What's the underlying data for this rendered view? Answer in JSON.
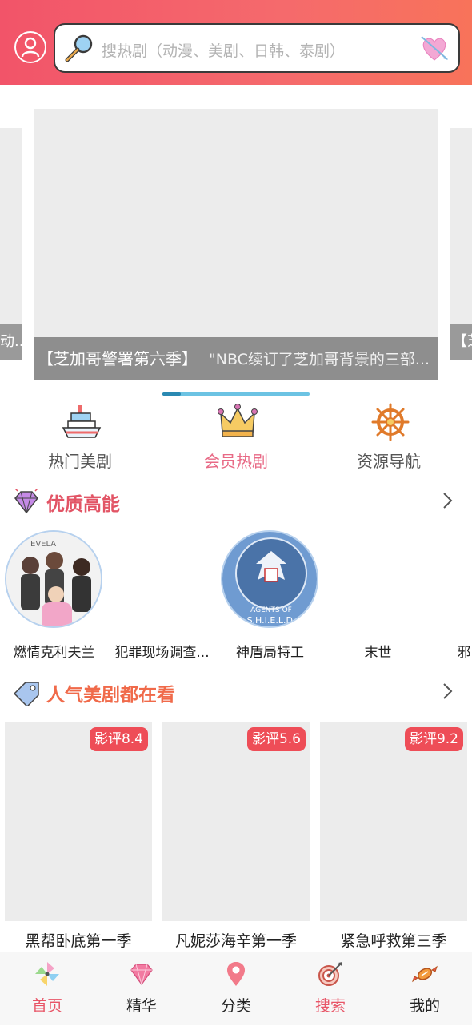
{
  "header": {
    "search_placeholder": "搜热剧（动漫、美剧、日韩、泰剧）"
  },
  "banner": {
    "left_card_caption": "动...",
    "right_card_caption": "【芝",
    "title": "【芝加哥警署第六季】",
    "description": "\"NBC续订了芝加哥背景的三部..."
  },
  "quick_nav": [
    {
      "label": "热门美剧",
      "icon": "ship-icon"
    },
    {
      "label": "会员热剧",
      "icon": "crown-icon"
    },
    {
      "label": "资源导航",
      "icon": "ship-wheel-icon"
    }
  ],
  "section_quality": {
    "title": "优质高能",
    "items": [
      "燃情克利夫兰",
      "犯罪现场调查...",
      "神盾局特工",
      "末世",
      "邪"
    ]
  },
  "section_popular": {
    "title": "人气美剧都在看",
    "items": [
      {
        "name": "黑帮卧底第一季",
        "rating": "影评8.4"
      },
      {
        "name": "凡妮莎海辛第一季",
        "rating": "影评5.6"
      },
      {
        "name": "紧急呼救第三季",
        "rating": "影评9.2"
      }
    ]
  },
  "tabbar": [
    {
      "label": "首页",
      "icon": "pinwheel-icon"
    },
    {
      "label": "精华",
      "icon": "diamond-icon"
    },
    {
      "label": "分类",
      "icon": "location-pin-icon"
    },
    {
      "label": "搜索",
      "icon": "target-icon"
    },
    {
      "label": "我的",
      "icon": "candy-icon"
    }
  ],
  "colors": {
    "accent": "#e85567",
    "header_start": "#f25469",
    "header_end": "#f8735a",
    "badge": "#ee4d57"
  }
}
